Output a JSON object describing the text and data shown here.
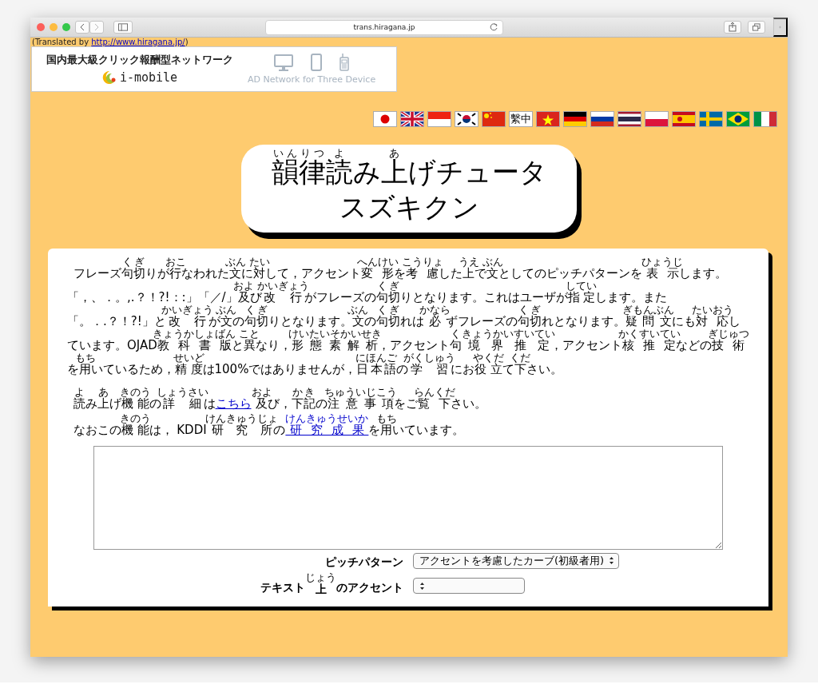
{
  "browser": {
    "address": "trans.hiragana.jp"
  },
  "translated_by": {
    "before": "(Translated by ",
    "link": "http://www.hiragana.jp/",
    "after": ")"
  },
  "ad_banner": {
    "headline": "国内最大級クリック報酬型ネットワーク",
    "brand": "i-mobile",
    "tagline": "AD Network for Three Device"
  },
  "languages": [
    {
      "kind": "jp"
    },
    {
      "kind": "gb"
    },
    {
      "kind": "id"
    },
    {
      "kind": "kr"
    },
    {
      "kind": "cn"
    },
    {
      "kind": "text",
      "label": "繫中"
    },
    {
      "kind": "vn"
    },
    {
      "kind": "de"
    },
    {
      "kind": "ru"
    },
    {
      "kind": "th"
    },
    {
      "kind": "pl"
    },
    {
      "kind": "es"
    },
    {
      "kind": "se"
    },
    {
      "kind": "br"
    },
    {
      "kind": "it"
    }
  ],
  "title": {
    "lines": [
      [
        {
          "text": "韻律",
          "ruby": "いんりつ"
        },
        {
          "text": "読",
          "ruby": "よ"
        },
        {
          "text": "み"
        },
        {
          "text": "上",
          "ruby": "あ"
        },
        {
          "text": "げチュータ"
        }
      ],
      [
        {
          "text": "スズキクン"
        }
      ]
    ]
  },
  "paragraphs": [
    [
      {
        "text": "フレーズ"
      },
      {
        "text": "句切",
        "ruby": "くぎ"
      },
      {
        "text": "りが"
      },
      {
        "text": "行",
        "ruby": "おこ"
      },
      {
        "text": "なわれた"
      },
      {
        "text": "文",
        "ruby": "ぶん"
      },
      {
        "text": "に"
      },
      {
        "text": "対",
        "ruby": "たい"
      },
      {
        "text": "して，アクセント"
      },
      {
        "text": "変形",
        "ruby": "へんけい"
      },
      {
        "text": "を"
      },
      {
        "text": "考慮",
        "ruby": "こうりょ"
      },
      {
        "text": "した"
      },
      {
        "text": "上",
        "ruby": "うえ"
      },
      {
        "text": "で"
      },
      {
        "text": "文",
        "ruby": "ぶん"
      },
      {
        "text": "としてのピッチパターンを "
      },
      {
        "text": "表示",
        "ruby": "ひょうじ"
      },
      {
        "text": "します。「，、．。,.？！?!：:」「／/」"
      },
      {
        "text": "及",
        "ruby": "およ"
      },
      {
        "text": "び"
      },
      {
        "text": "改行",
        "ruby": "かいぎょう"
      },
      {
        "text": "がフレーズの"
      },
      {
        "text": "句切",
        "ruby": "くぎ"
      },
      {
        "text": "りとなります。これはユーザが"
      },
      {
        "text": "指定",
        "ruby": "してい"
      },
      {
        "text": "します。また「。．.？！?!」と"
      },
      {
        "text": "改行",
        "ruby": "かいぎょう"
      },
      {
        "text": "が"
      },
      {
        "text": "文",
        "ruby": "ぶん"
      },
      {
        "text": "の"
      },
      {
        "text": "句切",
        "ruby": "くぎ"
      },
      {
        "text": "りとなります。"
      },
      {
        "text": "文",
        "ruby": "ぶん"
      },
      {
        "text": "の"
      },
      {
        "text": "句切",
        "ruby": "くぎ"
      },
      {
        "text": "れは"
      },
      {
        "text": "必",
        "ruby": "かなら"
      },
      {
        "text": "ずフレーズの"
      },
      {
        "text": "句切",
        "ruby": "くぎ"
      },
      {
        "text": "れとなります。"
      },
      {
        "text": "疑問文",
        "ruby": "ぎもんぶん"
      },
      {
        "text": "にも"
      },
      {
        "text": "対応",
        "ruby": "たいおう"
      },
      {
        "text": "しています。OJAD"
      },
      {
        "text": "教科書版",
        "ruby": "きょうかしょばん"
      },
      {
        "text": "と"
      },
      {
        "text": "異",
        "ruby": "こと"
      },
      {
        "text": "なり，"
      },
      {
        "text": "形態素解析",
        "ruby": "けいたいそかいせき"
      },
      {
        "text": "，アクセント"
      },
      {
        "text": "句",
        "ruby": "く"
      },
      {
        "text": "境界推定",
        "ruby": "きょうかいすいてい"
      },
      {
        "text": "，アクセント"
      },
      {
        "text": "核推定",
        "ruby": "かくすいてい"
      },
      {
        "text": "などの"
      },
      {
        "text": "技術",
        "ruby": "ぎじゅつ"
      },
      {
        "text": "を"
      },
      {
        "text": "用",
        "ruby": "もち"
      },
      {
        "text": "いているため，"
      },
      {
        "text": "精度",
        "ruby": "せいど"
      },
      {
        "text": "は100%ではありませんが，"
      },
      {
        "text": "日本語",
        "ruby": "にほんご"
      },
      {
        "text": "の"
      },
      {
        "text": "学習",
        "ruby": "がくしゅう"
      },
      {
        "text": "にお"
      },
      {
        "text": "役立",
        "ruby": "やくだ"
      },
      {
        "text": "て"
      },
      {
        "text": "下",
        "ruby": "くだ"
      },
      {
        "text": "さい。"
      }
    ],
    [
      {
        "text": "読",
        "ruby": "よ"
      },
      {
        "text": "み"
      },
      {
        "text": "上",
        "ruby": "あ"
      },
      {
        "text": "げ"
      },
      {
        "text": "機能",
        "ruby": "きのう"
      },
      {
        "text": "の"
      },
      {
        "text": "詳細",
        "ruby": "しょうさい"
      },
      {
        "text": "は"
      },
      {
        "text": "こちら",
        "link": true
      },
      {
        "text": "及",
        "ruby": "およ"
      },
      {
        "text": "び，"
      },
      {
        "text": "下記",
        "ruby": "かき"
      },
      {
        "text": "の"
      },
      {
        "text": "注意事項",
        "ruby": "ちゅういじこう"
      },
      {
        "text": "をご"
      },
      {
        "text": "覧下",
        "ruby": "らんくだ"
      },
      {
        "text": "さい。"
      }
    ],
    [
      {
        "text": "なおこの"
      },
      {
        "text": "機能",
        "ruby": "きのう"
      },
      {
        "text": "は， KDDI "
      },
      {
        "text": "研究所",
        "ruby": "けんきゅうじょ"
      },
      {
        "text": "の"
      },
      {
        "text": "研究成果",
        "ruby": "けんきゅうせいか",
        "link": true
      },
      {
        "text": "を"
      },
      {
        "text": "用",
        "ruby": "もち"
      },
      {
        "text": "いています。"
      }
    ]
  ],
  "form_rows": [
    {
      "label": [
        {
          "text": "ピッチパターン"
        }
      ],
      "value": "アクセントを考慮したカーブ(初級者用)"
    },
    {
      "label": [
        {
          "text": "テキスト"
        },
        {
          "text": "上",
          "ruby": "じょう"
        },
        {
          "text": "のアクセント"
        }
      ]
    }
  ]
}
